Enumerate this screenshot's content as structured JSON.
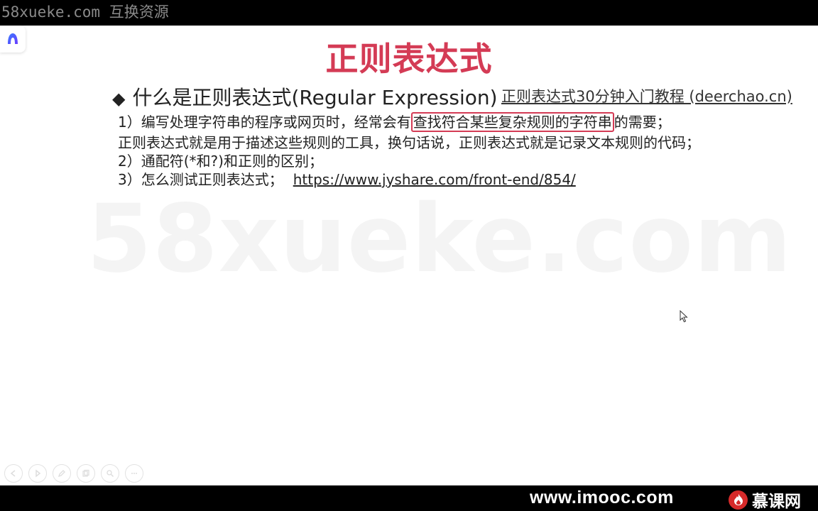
{
  "top_watermark": "58xueke.com 互换资源",
  "center_watermark": "58xueke.com",
  "slide": {
    "title": "正则表达式",
    "subheading": {
      "bullet": "◆",
      "text": "什么是正则表达式(Regular Expression)"
    },
    "tutorial_link": "正则表达式30分钟入门教程 (deerchao.cn)",
    "line1": {
      "before": "1）编写处理字符串的程序或网页时，经常会有",
      "highlight": "查找符合某些复杂规则的字符串",
      "after": "的需要；"
    },
    "line2": "正则表达式就是用于描述这些规则的工具，换句话说，正则表达式就是记录文本规则的代码；",
    "line3": "2）通配符(*和?)和正则的区别；",
    "line4": {
      "label": "3）怎么测试正则表达式；",
      "url": "https://www.jyshare.com/front-end/854/"
    }
  },
  "bottom_bar": {
    "url": "www.imooc.com",
    "logo_name": "慕课网"
  },
  "colors": {
    "title": "#d43b55",
    "highlight_border": "#d43b55",
    "logo_red": "#d62a2a"
  },
  "icons": {
    "side_badge": "app-logo-icon",
    "controls": [
      "prev-icon",
      "play-icon",
      "pen-icon",
      "copy-icon",
      "zoom-icon",
      "more-icon"
    ]
  }
}
